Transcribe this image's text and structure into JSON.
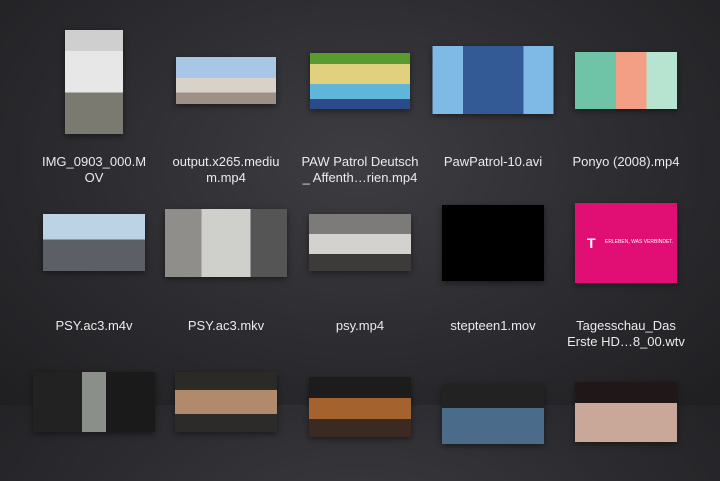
{
  "items": [
    {
      "label": "IMG_0903_000.M\nOV",
      "thumb": "screenshot-thumb"
    },
    {
      "label": "output.x265.mediu\nm.mp4",
      "thumb": "city-thumb"
    },
    {
      "label": "PAW Patrol Deutsch\n_ Affenth…rien.mp4",
      "thumb": "paw-patrol-game-thumb"
    },
    {
      "label": "PawPatrol-10.avi",
      "thumb": "paw-patrol-vehicle-thumb"
    },
    {
      "label": "Ponyo (2008).mp4",
      "thumb": "ponyo-thumb"
    },
    {
      "label": "PSY.ac3.m4v",
      "thumb": "psy-thumb"
    },
    {
      "label": "PSY.ac3.mkv",
      "thumb": "psy-dance-thumb"
    },
    {
      "label": "psy.mp4",
      "thumb": "psy-office-thumb"
    },
    {
      "label": "stepteen1.mov",
      "thumb": "black-thumb"
    },
    {
      "label": "Tagesschau_Das\nErste HD…8_00.wtv",
      "thumb": "telekom-thumb"
    },
    {
      "label": "",
      "thumb": "dark-street-thumb"
    },
    {
      "label": "",
      "thumb": "news-anchor-thumb"
    },
    {
      "label": "",
      "thumb": "stage-thumb"
    },
    {
      "label": "",
      "thumb": "blue-scene-thumb"
    },
    {
      "label": "",
      "thumb": "closeup-thumb"
    }
  ],
  "telekom": {
    "logo": "T",
    "text": "ERLEBEN, WAS VERBINDET."
  }
}
